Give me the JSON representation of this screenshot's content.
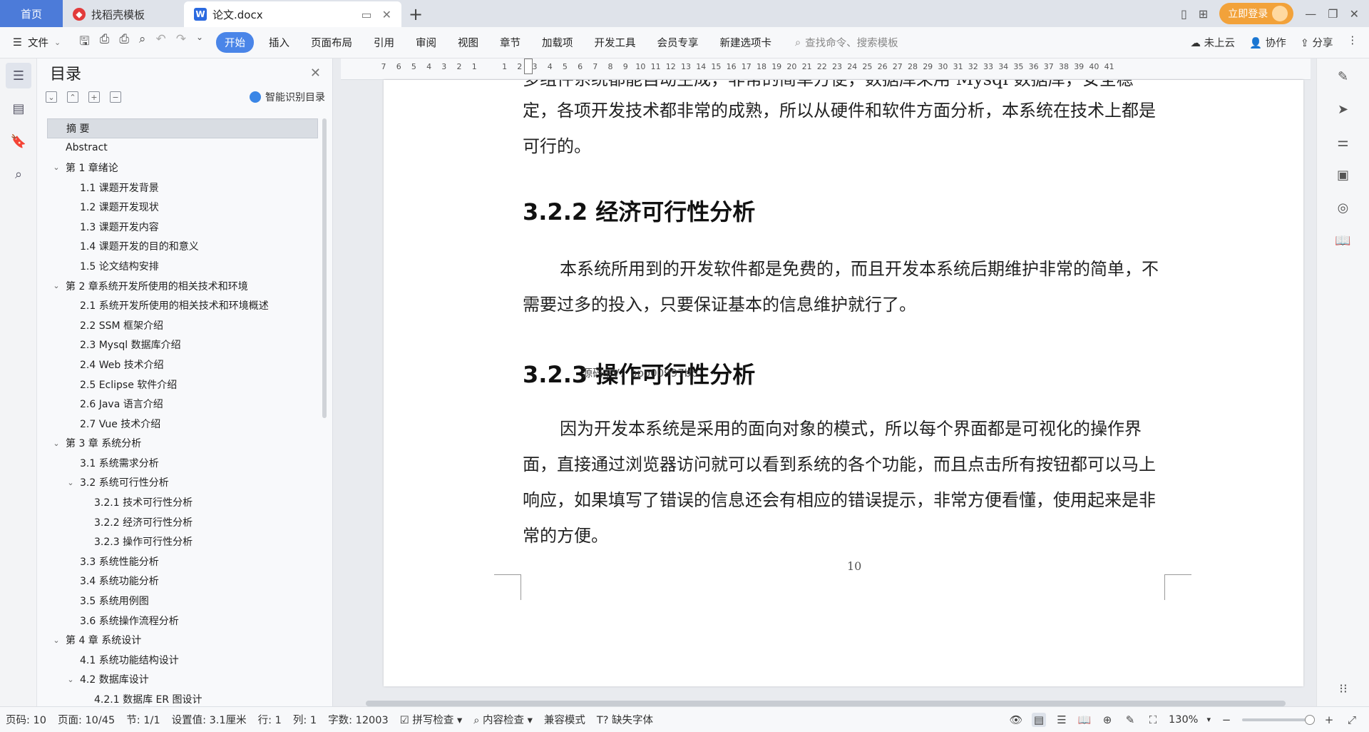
{
  "tabs": {
    "home": "首页",
    "template": "找稻壳模板",
    "doc": "论文.docx",
    "new_tab": "+"
  },
  "account": {
    "login_label": "立即登录"
  },
  "menu": {
    "file_label": "文件",
    "tabs": [
      "开始",
      "插入",
      "页面布局",
      "引用",
      "审阅",
      "视图",
      "章节",
      "加载项",
      "开发工具",
      "会员专享",
      "新建选项卡"
    ],
    "search_placeholder": "查找命令、搜索模板",
    "cloud": "未上云",
    "collab": "协作",
    "share": "分享"
  },
  "toc": {
    "title": "目录",
    "smart_label": "智能识别目录",
    "items": [
      {
        "label": "摘  要",
        "level": 0,
        "selected": true
      },
      {
        "label": "Abstract",
        "level": 0
      },
      {
        "label": "第 1 章绪论",
        "level": 0,
        "expanded": true
      },
      {
        "label": "1.1 课题开发背景",
        "level": 1
      },
      {
        "label": "1.2 课题开发现状",
        "level": 1
      },
      {
        "label": "1.3 课题开发内容",
        "level": 1
      },
      {
        "label": "1.4 课题开发的目的和意义",
        "level": 1
      },
      {
        "label": "1.5 论文结构安排",
        "level": 1
      },
      {
        "label": "第 2 章系统开发所使用的相关技术和环境",
        "level": 0,
        "expanded": true
      },
      {
        "label": "2.1 系统开发所使用的相关技术和环境概述",
        "level": 1
      },
      {
        "label": "2.2 SSM 框架介绍",
        "level": 1
      },
      {
        "label": "2.3 Mysql 数据库介绍",
        "level": 1
      },
      {
        "label": "2.4 Web 技术介绍",
        "level": 1
      },
      {
        "label": "2.5 Eclipse 软件介绍",
        "level": 1
      },
      {
        "label": "2.6 Java 语言介绍",
        "level": 1
      },
      {
        "label": "2.7 Vue 技术介绍",
        "level": 1
      },
      {
        "label": "第 3 章  系统分析",
        "level": 0,
        "expanded": true
      },
      {
        "label": "3.1 系统需求分析",
        "level": 1
      },
      {
        "label": "3.2 系统可行性分析",
        "level": 1,
        "expanded": true
      },
      {
        "label": "3.2.1 技术可行性分析",
        "level": 2
      },
      {
        "label": "3.2.2 经济可行性分析",
        "level": 2
      },
      {
        "label": "3.2.3 操作可行性分析",
        "level": 2
      },
      {
        "label": "3.3 系统性能分析",
        "level": 1
      },
      {
        "label": "3.4  系统功能分析",
        "level": 1
      },
      {
        "label": "3.5 系统用例图",
        "level": 1
      },
      {
        "label": "3.6 系统操作流程分析",
        "level": 1
      },
      {
        "label": "第 4 章  系统设计",
        "level": 0,
        "expanded": true
      },
      {
        "label": "4.1 系统功能结构设计",
        "level": 1
      },
      {
        "label": "4.2 数据库设计",
        "level": 1,
        "expanded": true
      },
      {
        "label": "4.2.1 数据库 ER 图设计",
        "level": 2
      }
    ]
  },
  "ruler_ticks": [
    "7",
    "6",
    "5",
    "4",
    "3",
    "2",
    "1",
    "",
    "1",
    "2",
    "3",
    "4",
    "5",
    "6",
    "7",
    "8",
    "9",
    "10",
    "11",
    "12",
    "13",
    "14",
    "15",
    "16",
    "17",
    "18",
    "19",
    "20",
    "21",
    "22",
    "23",
    "24",
    "25",
    "26",
    "27",
    "28",
    "29",
    "30",
    "31",
    "32",
    "33",
    "34",
    "35",
    "36",
    "37",
    "38",
    "39",
    "40",
    "41"
  ],
  "document": {
    "partial_line": "多组件系统都能自动生成，非常的简单方便，数据库采用 Mysql 数据库，安全稳",
    "para1": "定，各项开发技术都非常的成熟，所以从硬件和软件方面分析，本系统在技术上都是可行的。",
    "h322": "3.2.2 经济可行性分析",
    "para2": "本系统所用到的开发软件都是免费的，而且开发本系统后期维护非常的简单，不需要过多的投入，只要保证基本的信息维护就行了。",
    "h323": "3.2.3 操作可行性分析",
    "watermark": "源码+V：ppo00997bp",
    "para3": "因为开发本系统是采用的面向对象的模式，所以每个界面都是可视化的操作界面，直接通过浏览器访问就可以看到系统的各个功能，而且点击所有按钮都可以马上响应，如果填写了错误的信息还会有相应的错误提示，非常方便看懂，使用起来是非常的方便。",
    "page_number": "10"
  },
  "status": {
    "page_code": "页码: 10",
    "page": "页面: 10/45",
    "section": "节: 1/1",
    "setting": "设置值: 3.1厘米",
    "row": "行: 1",
    "col": "列: 1",
    "words": "字数: 12003",
    "spell": "拼写检查",
    "content_check": "内容检查",
    "compat": "兼容模式",
    "missing_font": "缺失字体",
    "zoom": "130%"
  },
  "colors": {
    "accent": "#4a85e8",
    "home_tab": "#4c7bd9",
    "login": "#f2a23a"
  }
}
